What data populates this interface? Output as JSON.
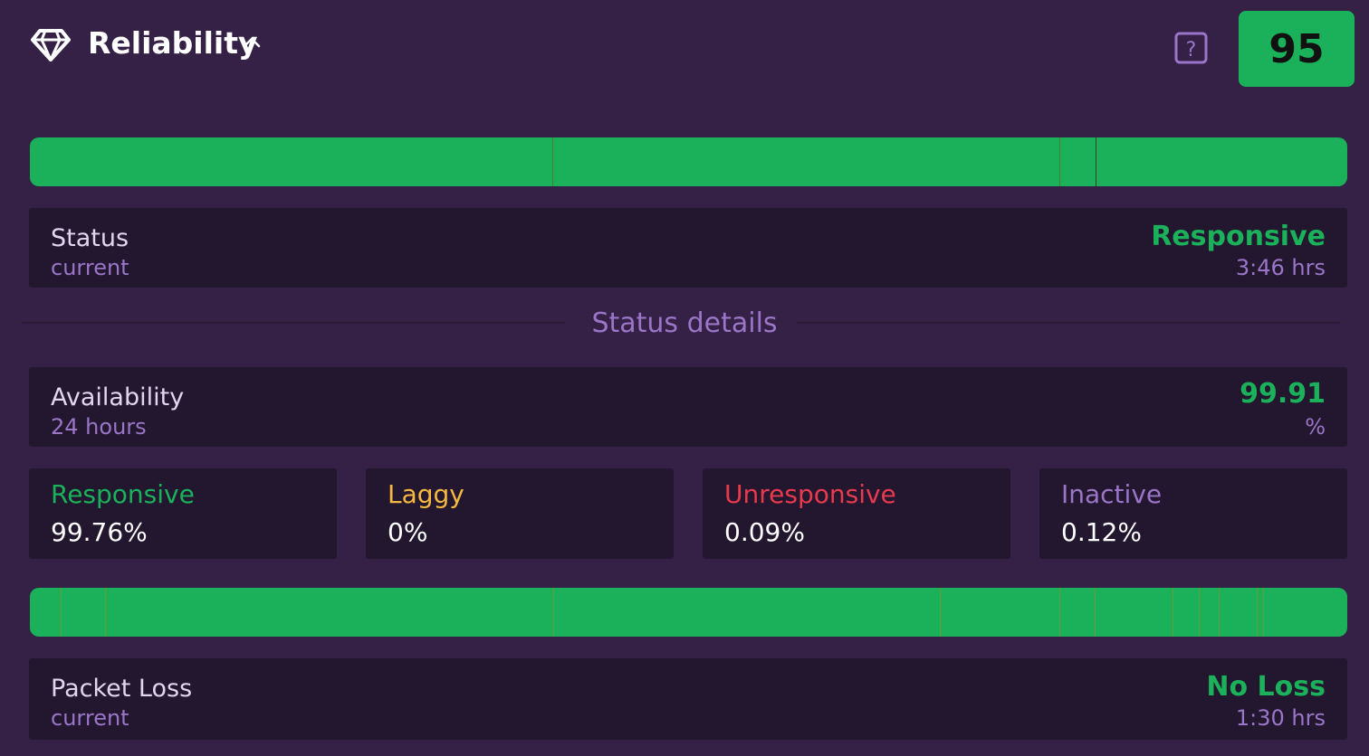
{
  "header": {
    "title": "Reliability",
    "score": "95"
  },
  "status": {
    "label": "Status",
    "sublabel": "current",
    "value": "Responsive",
    "duration": "3:46 hrs"
  },
  "divider": {
    "label": "Status details"
  },
  "availability": {
    "label": "Availability",
    "sublabel": "24 hours",
    "value": "99.91",
    "unit": "%"
  },
  "breakdown": [
    {
      "label": "Responsive",
      "value": "99.76%",
      "color": "#1bb15a"
    },
    {
      "label": "Laggy",
      "value": "0%",
      "color": "#f4b740"
    },
    {
      "label": "Unresponsive",
      "value": "0.09%",
      "color": "#e8394d"
    },
    {
      "label": "Inactive",
      "value": "0.12%",
      "color": "#9a75c8"
    }
  ],
  "packet_loss": {
    "label": "Packet Loss",
    "sublabel": "current",
    "value": "No Loss",
    "duration": "1:30 hrs"
  },
  "colors": {
    "background": "#352046",
    "panel": "#22172f",
    "good": "#1bb15a",
    "accent_purple": "#9a75c8"
  }
}
